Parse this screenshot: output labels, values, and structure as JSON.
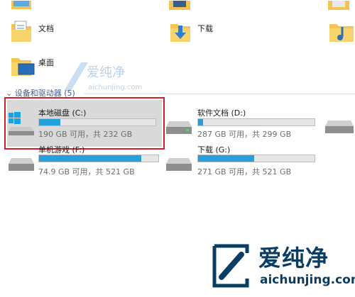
{
  "folders": [
    {
      "name": "文档",
      "icon": "documents-folder-icon"
    },
    {
      "name": "下载",
      "icon": "downloads-folder-icon"
    },
    {
      "name": "桌面",
      "icon": "desktop-folder-icon"
    }
  ],
  "section": {
    "title": "设备和驱动器 (5)"
  },
  "drives": [
    {
      "name": "本地磁盘 (C:)",
      "space": "190 GB 可用，共 232 GB",
      "used_fraction": 0.18,
      "icon": "windows-drive-icon"
    },
    {
      "name": "软件文档 (D:)",
      "space": "287 GB 可用，共 299 GB",
      "used_fraction": 0.04,
      "icon": "hard-drive-icon"
    },
    {
      "name": "单机游戏 (F:)",
      "space": "74.9 GB 可用，共 521 GB",
      "used_fraction": 0.86,
      "icon": "hard-drive-icon"
    },
    {
      "name": "下载 (G:)",
      "space": "271 GB 可用，共 521 GB",
      "used_fraction": 0.48,
      "icon": "hard-drive-icon"
    }
  ],
  "watermark": {
    "brand": "爱纯净",
    "url": "aichunjing.com"
  },
  "colors": {
    "bar_fill": "#26a0da",
    "selection_border": "#d0202a",
    "header_text": "#3c5a87"
  }
}
